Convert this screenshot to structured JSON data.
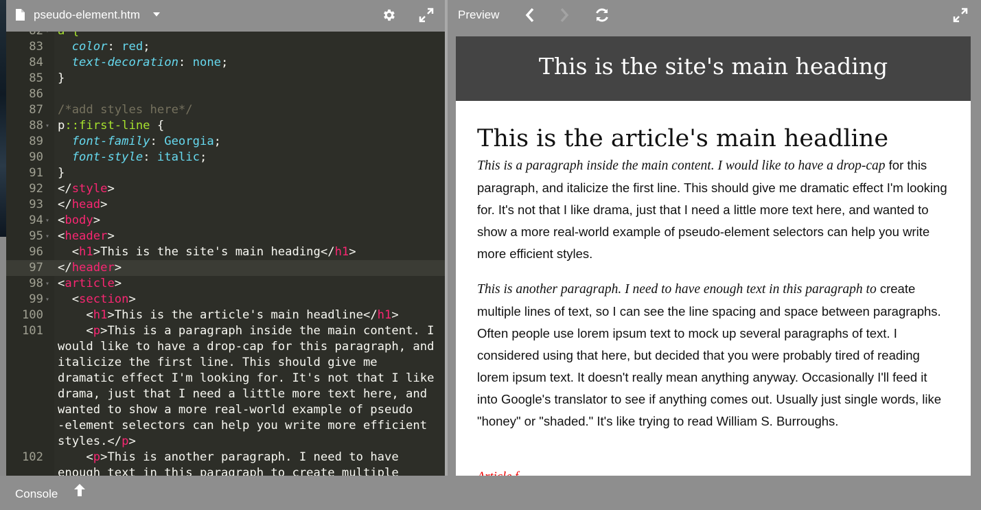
{
  "editor": {
    "file_name": "pseudo-element.htm",
    "lines": [
      {
        "n": "82",
        "fold": "▾",
        "tokens": [
          {
            "t": "a {",
            "c": "sel"
          }
        ]
      },
      {
        "n": "83",
        "fold": "",
        "tokens": [
          {
            "t": "  ",
            "c": "txt"
          },
          {
            "t": "color",
            "c": "prop"
          },
          {
            "t": ": ",
            "c": "txt"
          },
          {
            "t": "red",
            "c": "val"
          },
          {
            "t": ";",
            "c": "txt"
          }
        ]
      },
      {
        "n": "84",
        "fold": "",
        "tokens": [
          {
            "t": "  ",
            "c": "txt"
          },
          {
            "t": "text-decoration",
            "c": "prop"
          },
          {
            "t": ": ",
            "c": "txt"
          },
          {
            "t": "none",
            "c": "val"
          },
          {
            "t": ";",
            "c": "txt"
          }
        ]
      },
      {
        "n": "85",
        "fold": "",
        "tokens": [
          {
            "t": "}",
            "c": "txt"
          }
        ]
      },
      {
        "n": "86",
        "fold": "",
        "tokens": []
      },
      {
        "n": "87",
        "fold": "",
        "tokens": [
          {
            "t": "/*add styles here*/",
            "c": "cmt"
          }
        ]
      },
      {
        "n": "88",
        "fold": "▾",
        "tokens": [
          {
            "t": "p",
            "c": "txt"
          },
          {
            "t": "::first-line",
            "c": "sel"
          },
          {
            "t": " {",
            "c": "txt"
          }
        ]
      },
      {
        "n": "89",
        "fold": "",
        "tokens": [
          {
            "t": "  ",
            "c": "txt"
          },
          {
            "t": "font-family",
            "c": "prop"
          },
          {
            "t": ": ",
            "c": "txt"
          },
          {
            "t": "Georgia",
            "c": "val"
          },
          {
            "t": ";",
            "c": "txt"
          }
        ]
      },
      {
        "n": "90",
        "fold": "",
        "tokens": [
          {
            "t": "  ",
            "c": "txt"
          },
          {
            "t": "font-style",
            "c": "prop"
          },
          {
            "t": ": ",
            "c": "txt"
          },
          {
            "t": "italic",
            "c": "val"
          },
          {
            "t": ";",
            "c": "txt"
          }
        ]
      },
      {
        "n": "91",
        "fold": "",
        "tokens": [
          {
            "t": "}",
            "c": "txt"
          }
        ]
      },
      {
        "n": "92",
        "fold": "",
        "tokens": [
          {
            "t": "</",
            "c": "txt"
          },
          {
            "t": "style",
            "c": "kw"
          },
          {
            "t": ">",
            "c": "txt"
          }
        ]
      },
      {
        "n": "93",
        "fold": "",
        "tokens": [
          {
            "t": "</",
            "c": "txt"
          },
          {
            "t": "head",
            "c": "kw"
          },
          {
            "t": ">",
            "c": "txt"
          }
        ]
      },
      {
        "n": "94",
        "fold": "▾",
        "tokens": [
          {
            "t": "<",
            "c": "txt"
          },
          {
            "t": "body",
            "c": "kw"
          },
          {
            "t": ">",
            "c": "txt"
          }
        ]
      },
      {
        "n": "95",
        "fold": "▾",
        "tokens": [
          {
            "t": "<",
            "c": "txt"
          },
          {
            "t": "header",
            "c": "kw"
          },
          {
            "t": ">",
            "c": "txt"
          }
        ]
      },
      {
        "n": "96",
        "fold": "",
        "tokens": [
          {
            "t": "  <",
            "c": "txt"
          },
          {
            "t": "h1",
            "c": "kw"
          },
          {
            "t": ">This is the site's main heading</",
            "c": "txt"
          },
          {
            "t": "h1",
            "c": "kw"
          },
          {
            "t": ">",
            "c": "txt"
          }
        ]
      },
      {
        "n": "97",
        "fold": "",
        "active": true,
        "tokens": [
          {
            "t": "</",
            "c": "txt"
          },
          {
            "t": "header",
            "c": "kw"
          },
          {
            "t": ">",
            "c": "txt"
          }
        ]
      },
      {
        "n": "98",
        "fold": "▾",
        "tokens": [
          {
            "t": "<",
            "c": "txt"
          },
          {
            "t": "article",
            "c": "kw"
          },
          {
            "t": ">",
            "c": "txt"
          }
        ]
      },
      {
        "n": "99",
        "fold": "▾",
        "tokens": [
          {
            "t": "  <",
            "c": "txt"
          },
          {
            "t": "section",
            "c": "kw"
          },
          {
            "t": ">",
            "c": "txt"
          }
        ]
      },
      {
        "n": "100",
        "fold": "",
        "tokens": [
          {
            "t": "    <",
            "c": "txt"
          },
          {
            "t": "h1",
            "c": "kw"
          },
          {
            "t": ">This is the article's main headline</",
            "c": "txt"
          },
          {
            "t": "h1",
            "c": "kw"
          },
          {
            "t": ">",
            "c": "txt"
          }
        ]
      },
      {
        "n": "101",
        "fold": "",
        "tokens": [
          {
            "t": "    <",
            "c": "txt"
          },
          {
            "t": "p",
            "c": "kw"
          },
          {
            "t": ">This is a paragraph inside the main content. I",
            "c": "txt"
          }
        ]
      },
      {
        "n": "",
        "fold": "",
        "tokens": [
          {
            "t": "would like to have a drop-cap for this paragraph, and",
            "c": "txt"
          }
        ]
      },
      {
        "n": "",
        "fold": "",
        "tokens": [
          {
            "t": "italicize the first line. This should give me",
            "c": "txt"
          }
        ]
      },
      {
        "n": "",
        "fold": "",
        "tokens": [
          {
            "t": "dramatic effect I'm looking for. It's not that I like",
            "c": "txt"
          }
        ]
      },
      {
        "n": "",
        "fold": "",
        "tokens": [
          {
            "t": "drama, just that I need a little more text here, and",
            "c": "txt"
          }
        ]
      },
      {
        "n": "",
        "fold": "",
        "tokens": [
          {
            "t": "wanted to show a more real-world example of pseudo",
            "c": "txt"
          }
        ]
      },
      {
        "n": "",
        "fold": "",
        "tokens": [
          {
            "t": "-element selectors can help you write more efficient",
            "c": "txt"
          }
        ]
      },
      {
        "n": "",
        "fold": "",
        "tokens": [
          {
            "t": "styles.</",
            "c": "txt"
          },
          {
            "t": "p",
            "c": "kw"
          },
          {
            "t": ">",
            "c": "txt"
          }
        ]
      },
      {
        "n": "102",
        "fold": "",
        "tokens": [
          {
            "t": "    <",
            "c": "txt"
          },
          {
            "t": "p",
            "c": "kw"
          },
          {
            "t": ">This is another paragraph. I need to have",
            "c": "txt"
          }
        ]
      },
      {
        "n": "",
        "fold": "",
        "tokens": [
          {
            "t": "enough text in this paragraph to create multiple",
            "c": "txt"
          }
        ]
      }
    ]
  },
  "preview": {
    "label": "Preview",
    "site_heading": "This is the site's main heading",
    "article_headline": "This is the article's main headline",
    "p1_first": "This is a paragraph inside the main content. I would like to have a drop-cap",
    "p1_rest": "for this paragraph, and italicize the first line. This should give me dramatic effect I'm looking for. It's not that I like drama, just that I need a little more text here, and wanted to show a more real-world example of pseudo-element selectors can help you write more efficient styles.",
    "p2_first": "This is another paragraph. I need to have enough text in this paragraph to",
    "p2_rest": "create multiple lines of text, so I can see the line spacing and space between paragraphs. Often people use lorem ipsum text to mock up several paragraphs of text. I considered using that here, but decided that you were probably tired of reading lorem ipsum text. It doesn't really mean anything anyway. Occasionally I'll feed it into Google's translator to see if anything comes out. Usually just single words, like \"honey\" or \"shaded.\" It's like trying to read William S. Burroughs.",
    "p3_partial": "Article f"
  },
  "console": {
    "label": "Console"
  },
  "colors": {
    "editor_bg": "#2d2e28",
    "toolbar_bg": "#8e8e8e",
    "keyword": "#f92672",
    "property": "#66d9ef",
    "selector": "#a6e22e",
    "comment": "#75715e"
  }
}
